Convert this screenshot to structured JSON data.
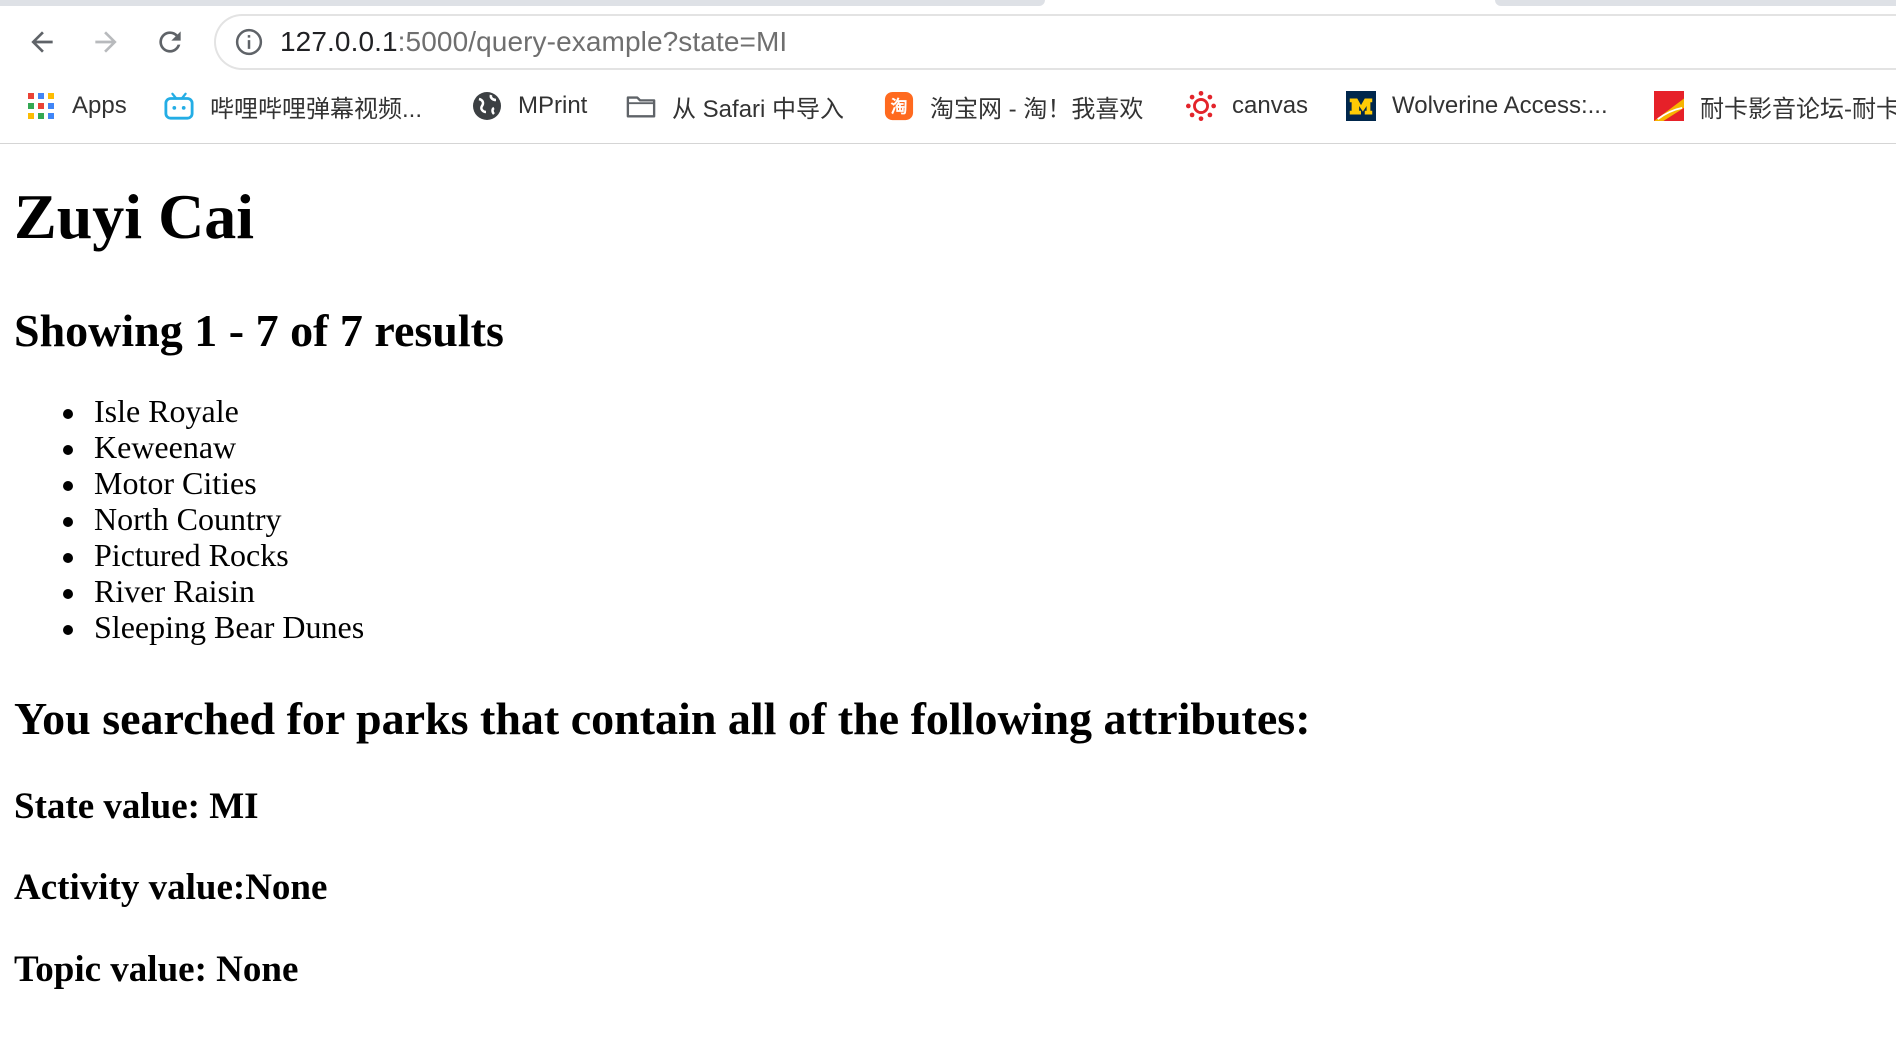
{
  "browser": {
    "url_host": "127.0.0.1",
    "url_rest": ":5000/query-example?state=MI",
    "bookmarks": [
      {
        "label": "Apps",
        "icon": "apps-grid-icon"
      },
      {
        "label": "哔哩哔哩弹幕视频...",
        "icon": "bilibili-icon"
      },
      {
        "label": "MPrint",
        "icon": "globe-icon"
      },
      {
        "label": "从 Safari 中导入",
        "icon": "folder-icon"
      },
      {
        "label": "淘宝网 - 淘！我喜欢",
        "icon": "taobao-icon"
      },
      {
        "label": "canvas",
        "icon": "canvas-icon"
      },
      {
        "label": "Wolverine Access:...",
        "icon": "michigan-m-icon"
      },
      {
        "label": "耐卡影音论坛-耐卡",
        "icon": "naika-icon"
      }
    ]
  },
  "page": {
    "title": "Zuyi Cai",
    "results_heading": "Showing 1 - 7 of 7 results",
    "parks": [
      "Isle Royale",
      "Keweenaw",
      "Motor Cities",
      "North Country",
      "Pictured Rocks",
      "River Raisin",
      "Sleeping Bear Dunes"
    ],
    "searched_heading": "You searched for parks that contain all of the following attributes:",
    "state_line": "State value: MI",
    "activity_line": "Activity value:None",
    "topic_line": "Topic value: None"
  }
}
